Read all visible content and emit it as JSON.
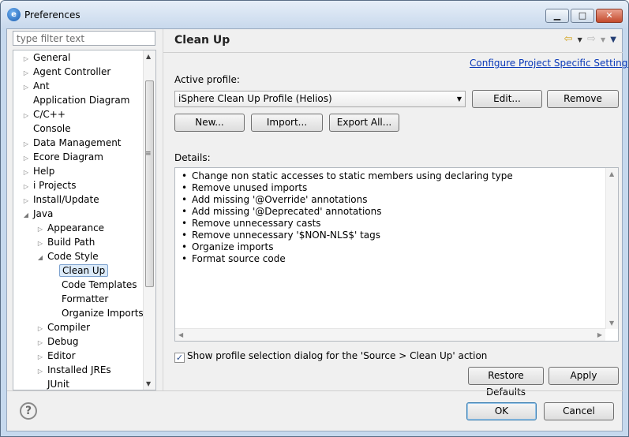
{
  "window": {
    "title": "Preferences",
    "app_icon": "eclipse-icon"
  },
  "window_controls": {
    "minimize": "▁",
    "maximize": "□",
    "close": "✕"
  },
  "filter": {
    "placeholder": "type filter text"
  },
  "tree": {
    "items": [
      {
        "label": "General",
        "level": 0,
        "expander": "collapsed"
      },
      {
        "label": "Agent Controller",
        "level": 0,
        "expander": "collapsed"
      },
      {
        "label": "Ant",
        "level": 0,
        "expander": "collapsed"
      },
      {
        "label": "Application Diagram",
        "level": 0,
        "expander": "none"
      },
      {
        "label": "C/C++",
        "level": 0,
        "expander": "collapsed"
      },
      {
        "label": "Console",
        "level": 0,
        "expander": "none"
      },
      {
        "label": "Data Management",
        "level": 0,
        "expander": "collapsed"
      },
      {
        "label": "Ecore Diagram",
        "level": 0,
        "expander": "collapsed"
      },
      {
        "label": "Help",
        "level": 0,
        "expander": "collapsed"
      },
      {
        "label": "i Projects",
        "level": 0,
        "expander": "collapsed"
      },
      {
        "label": "Install/Update",
        "level": 0,
        "expander": "collapsed"
      },
      {
        "label": "Java",
        "level": 0,
        "expander": "expanded"
      },
      {
        "label": "Appearance",
        "level": 1,
        "expander": "collapsed"
      },
      {
        "label": "Build Path",
        "level": 1,
        "expander": "collapsed"
      },
      {
        "label": "Code Style",
        "level": 1,
        "expander": "expanded"
      },
      {
        "label": "Clean Up",
        "level": 2,
        "expander": "none",
        "selected": true
      },
      {
        "label": "Code Templates",
        "level": 2,
        "expander": "none"
      },
      {
        "label": "Formatter",
        "level": 2,
        "expander": "none"
      },
      {
        "label": "Organize Imports",
        "level": 2,
        "expander": "none"
      },
      {
        "label": "Compiler",
        "level": 1,
        "expander": "collapsed"
      },
      {
        "label": "Debug",
        "level": 1,
        "expander": "collapsed"
      },
      {
        "label": "Editor",
        "level": 1,
        "expander": "collapsed"
      },
      {
        "label": "Installed JREs",
        "level": 1,
        "expander": "collapsed"
      },
      {
        "label": "JUnit",
        "level": 1,
        "expander": "none"
      }
    ]
  },
  "page": {
    "title": "Clean Up",
    "nav": {
      "back_icon": "back-arrow-icon",
      "forward_icon": "forward-arrow-icon",
      "menu_icon": "view-menu-icon"
    },
    "configure_link": "Configure Project Specific Settings...",
    "active_profile_label": "Active profile:",
    "active_profile_value": "iSphere Clean Up Profile (Helios)",
    "buttons": {
      "edit": "Edit...",
      "remove": "Remove",
      "new": "New...",
      "import": "Import...",
      "export_all": "Export All..."
    },
    "details_label": "Details:",
    "details": [
      "Change non static accesses to static members using declaring type",
      "Remove unused imports",
      "Add missing '@Override' annotations",
      "Add missing '@Deprecated' annotations",
      "Remove unnecessary casts",
      "Remove unnecessary '$NON-NLS$' tags",
      "Organize imports",
      "Format source code"
    ],
    "show_dialog_checkbox": {
      "label": "Show profile selection dialog for the 'Source > Clean Up' action",
      "checked": true
    },
    "restore_defaults": "Restore Defaults",
    "apply": "Apply"
  },
  "dialog": {
    "ok": "OK",
    "cancel": "Cancel",
    "help_icon": "help-icon"
  }
}
